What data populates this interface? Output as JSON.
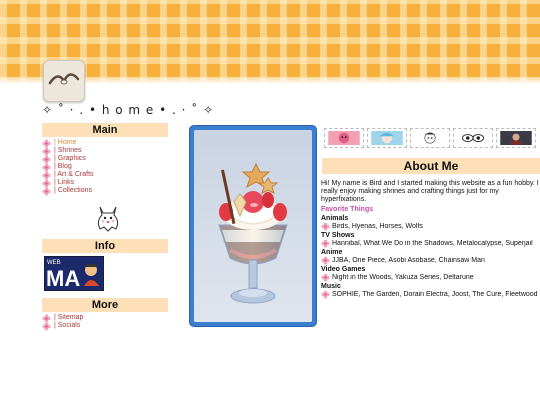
{
  "header": {
    "site_title": "✧ ˚ · . • h o m e • . · ˚ ✧"
  },
  "sidebar": {
    "main_heading": "Main",
    "nav_items": [
      {
        "label": "| Home",
        "current": true
      },
      {
        "label": "| Shrines",
        "current": false
      },
      {
        "label": "| Graphics",
        "current": false
      },
      {
        "label": "| Blog",
        "current": false
      },
      {
        "label": "| Art & Crafts",
        "current": false
      },
      {
        "label": "| Links",
        "current": false
      },
      {
        "label": "| Collections",
        "current": false
      }
    ],
    "info_heading": "Info",
    "info_badge_text": "MA",
    "info_badge_small": "WEB",
    "more_heading": "More",
    "more_items": [
      {
        "label": "| Sitemap"
      },
      {
        "label": "| Socials"
      }
    ]
  },
  "about": {
    "heading": "About Me",
    "intro": "Hi! My name is Bird and I started making this website as a fun hobby. I really enjoy making shrines and crafting things just for my hyperfixations.",
    "favorites_title": "Favorite Things",
    "categories": [
      {
        "name": "Animals",
        "items": "Birds, Hyenas, Horses, Wolfs"
      },
      {
        "name": "TV Shows",
        "items": "Hannibal, What We Do in the Shadows, Metalocalypse, Superjail"
      },
      {
        "name": "Anime",
        "items": "JJBA, One Piece, Asobi Asobase, Chainsaw Man"
      },
      {
        "name": "Video Games",
        "items": "Night in the Woods, Yakuza Series, Deltarune"
      },
      {
        "name": "Music",
        "items": "SOPHIE, The Garden, Dorain Electra, Joost, The Cure, Fleetwood Mac"
      }
    ]
  },
  "colors": {
    "header_orange": "#f7b03c",
    "section_head_bg": "#fde0b7",
    "link_red": "#a83a3a",
    "link_current": "#e58a3a",
    "favorites_pink": "#c24fa5",
    "photo_frame_blue": "#3a7fd0"
  },
  "icons": {
    "nav_bullet": "pink-flower-icon",
    "avatar": "seagull-avatar",
    "mascot": "ghost-cat-mascot",
    "photo": "parfait-photo"
  }
}
